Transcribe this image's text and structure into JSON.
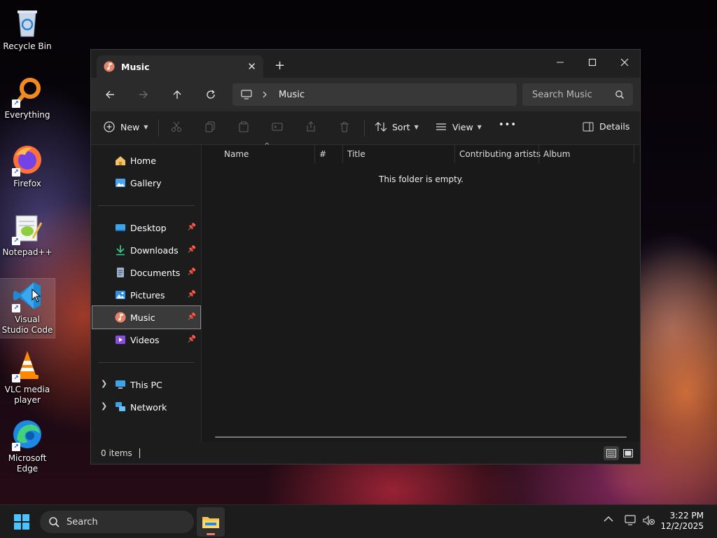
{
  "desktop": {
    "icons": [
      {
        "label": "Recycle Bin"
      },
      {
        "label": "Everything"
      },
      {
        "label": "Firefox"
      },
      {
        "label": "Notepad++"
      },
      {
        "label": "Visual Studio Code"
      },
      {
        "label": "VLC media player"
      },
      {
        "label": "Microsoft Edge"
      }
    ]
  },
  "window": {
    "tab_title": "Music",
    "tab_close": "✕",
    "new_tab": "+",
    "address": {
      "crumb": "Music"
    },
    "search_placeholder": "Search Music",
    "commands": {
      "new": "New",
      "sort": "Sort",
      "view": "View",
      "more": "•••",
      "details": "Details"
    },
    "nav": {
      "home": "Home",
      "gallery": "Gallery",
      "desktop": "Desktop",
      "downloads": "Downloads",
      "documents": "Documents",
      "pictures": "Pictures",
      "music": "Music",
      "videos": "Videos",
      "this_pc": "This PC",
      "network": "Network"
    },
    "columns": [
      "Name",
      "#",
      "Title",
      "Contributing artists",
      "Album"
    ],
    "empty_message": "This folder is empty.",
    "status": {
      "items": "0 items"
    }
  },
  "taskbar": {
    "search_label": "Search",
    "time": "3:22 PM",
    "date": "12/2/2025"
  },
  "colors": {
    "accent": "#4cc2ff",
    "window_bg": "#191919",
    "tab_bg": "#2b2b2b"
  }
}
